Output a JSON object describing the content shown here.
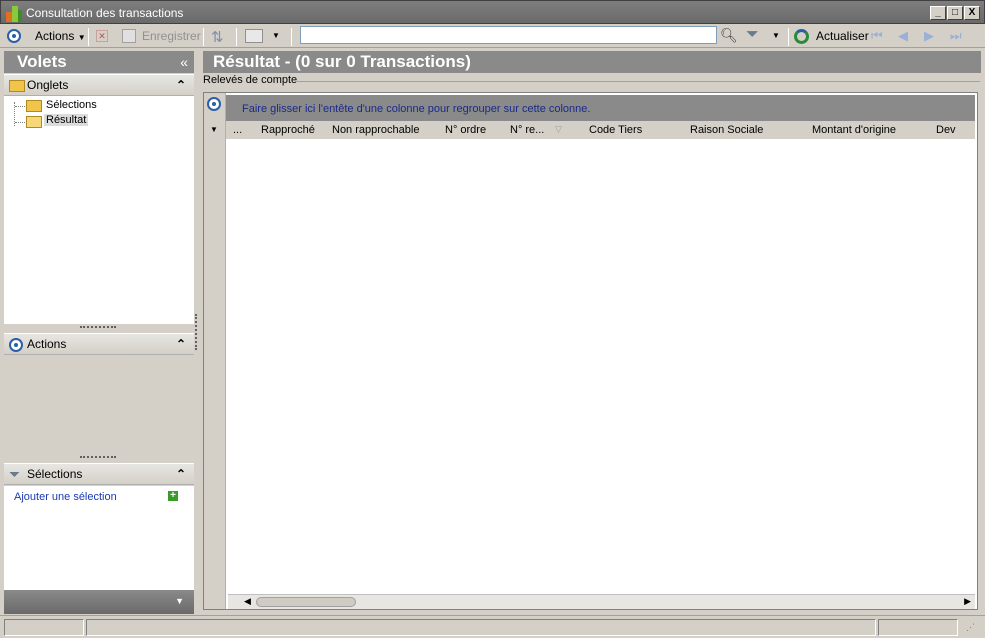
{
  "window": {
    "title": "Consultation des transactions",
    "controls": [
      "_",
      "□",
      "X"
    ]
  },
  "toolbar": {
    "actions_label": "Actions",
    "save_label": "Enregistrer",
    "search_value": "",
    "refresh_label": "Actualiser"
  },
  "left_panel": {
    "title": "Volets",
    "collapse_glyph": "«",
    "onglets": {
      "title": "Onglets",
      "items": [
        "Sélections",
        "Résultat"
      ],
      "selected": "Résultat"
    },
    "actions": {
      "title": "Actions"
    },
    "selections": {
      "title": "Sélections",
      "add_link": "Ajouter une sélection"
    }
  },
  "result": {
    "title": "Résultat - (0 sur 0 Transactions)",
    "tab_label": "Relevés de compte",
    "group_hint": "Faire glisser ici l'entête d'une colonne pour regrouper sur cette colonne.",
    "columns": [
      "...",
      "Rapproché",
      "Non rapprochable",
      "N° ordre",
      "N° re...",
      "Code Tiers",
      "Raison Sociale",
      "Montant d'origine",
      "Dev"
    ],
    "rows": []
  },
  "colors": {
    "header_gray": "#8a8a8a",
    "link_blue": "#1a3ab0",
    "group_text": "#1a2a8a",
    "accent_blue": "#2a5fa8"
  }
}
